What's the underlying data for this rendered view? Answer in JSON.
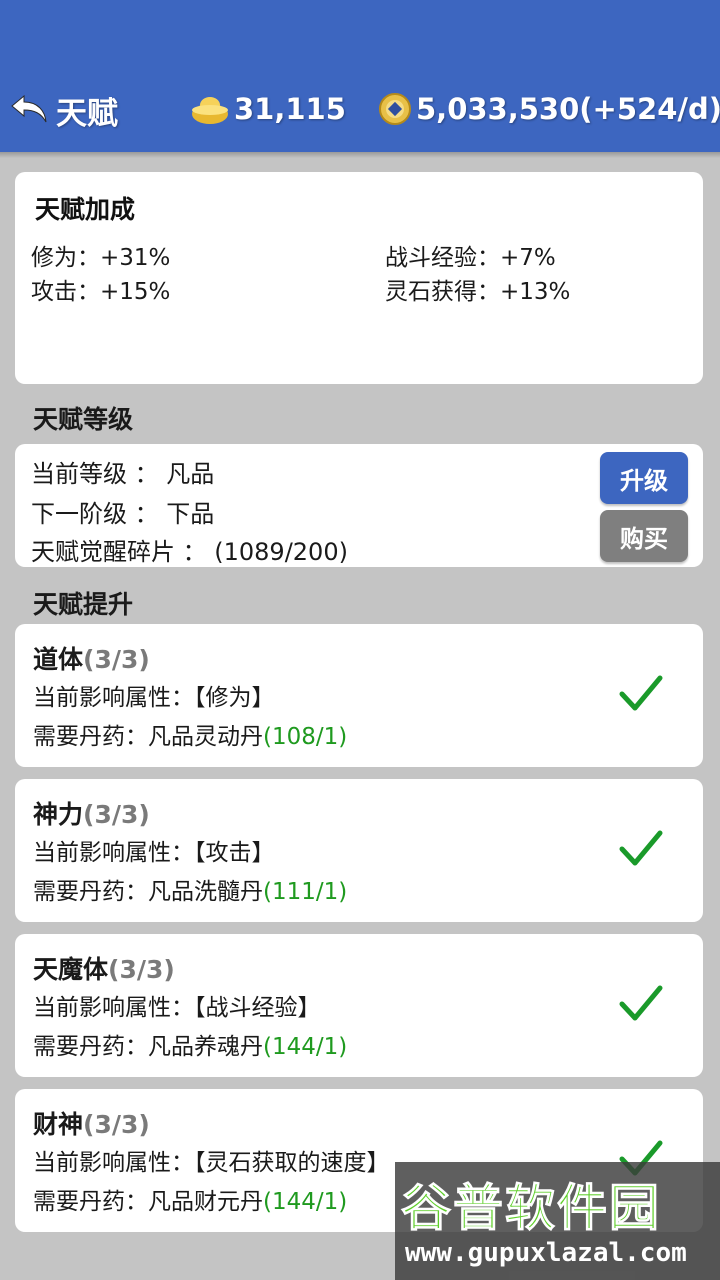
{
  "header": {
    "back_label": "天赋",
    "gold_amount": "31,115",
    "stone_amount": "5,033,530(+524/d)",
    "icons": [
      "back-arrow-icon",
      "gold-ingot-icon",
      "spirit-coin-icon"
    ]
  },
  "bonus": {
    "title": "天赋加成",
    "items": [
      {
        "label": "修为：+31%"
      },
      {
        "label": "战斗经验：+7%"
      },
      {
        "label": "攻击：+15%"
      },
      {
        "label": "灵石获得：+13%"
      }
    ]
  },
  "level": {
    "section_title": "天赋等级",
    "current": "当前等级 ： 凡品",
    "next": "下一阶级 ： 下品",
    "fragments": "天赋觉醒碎片 ： (1089/200)",
    "upgrade_label": "升级",
    "buy_label": "购买"
  },
  "talents": {
    "section_title": "天赋提升",
    "items": [
      {
        "name": "道体",
        "progress": "(3/3)",
        "attr": "当前影响属性：【修为】",
        "pill_label": "需要丹药：凡品灵动丹",
        "pill_count": "(108/1)"
      },
      {
        "name": "神力",
        "progress": "(3/3)",
        "attr": "当前影响属性：【攻击】",
        "pill_label": "需要丹药：凡品洗髓丹",
        "pill_count": "(111/1)"
      },
      {
        "name": "天魔体",
        "progress": "(3/3)",
        "attr": "当前影响属性：【战斗经验】",
        "pill_label": "需要丹药：凡品养魂丹",
        "pill_count": "(144/1)"
      },
      {
        "name": "财神",
        "progress": "(3/3)",
        "attr": "当前影响属性：【灵石获取的速度】",
        "pill_label": "需要丹药：凡品财元丹",
        "pill_count": "(144/1)"
      }
    ]
  },
  "watermark": {
    "title": "谷普软件园",
    "url": "www.gupuxlazal.com"
  },
  "colors": {
    "header_bg": "#3d66c0",
    "page_bg": "#c4c4c4",
    "count_green": "#1f9a1f",
    "check_green": "#1a9a2a",
    "buy_gray": "#7f7f7f"
  }
}
